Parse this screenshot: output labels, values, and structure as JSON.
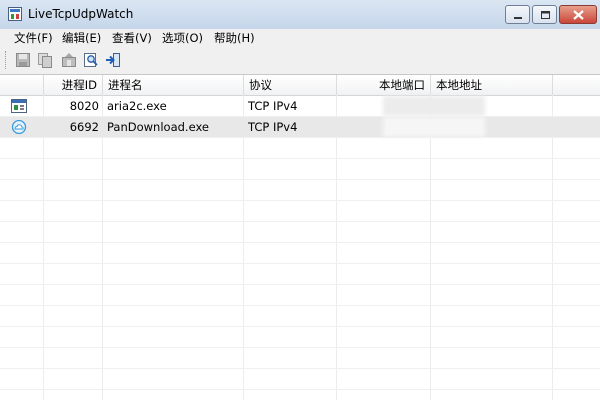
{
  "window": {
    "title": "LiveTcpUdpWatch"
  },
  "menu": [
    {
      "label": "文件(F)"
    },
    {
      "label": "编辑(E)"
    },
    {
      "label": "查看(V)"
    },
    {
      "label": "选项(O)"
    },
    {
      "label": "帮助(H)"
    }
  ],
  "toolbar": {
    "icons": [
      "save-icon",
      "copy-icon",
      "properties-icon",
      "find-icon",
      "exit-icon"
    ]
  },
  "table": {
    "columns": [
      "",
      "进程ID",
      "进程名",
      "协议",
      "本地端口",
      "本地地址"
    ],
    "rows": [
      {
        "icon": "aria2c-app-icon",
        "pid": "8020",
        "name": "aria2c.exe",
        "protocol": "TCP IPv4",
        "selected": false
      },
      {
        "icon": "cloud-app-icon",
        "pid": "6692",
        "name": "PanDownload.exe",
        "protocol": "TCP IPv4",
        "selected": true
      }
    ]
  }
}
